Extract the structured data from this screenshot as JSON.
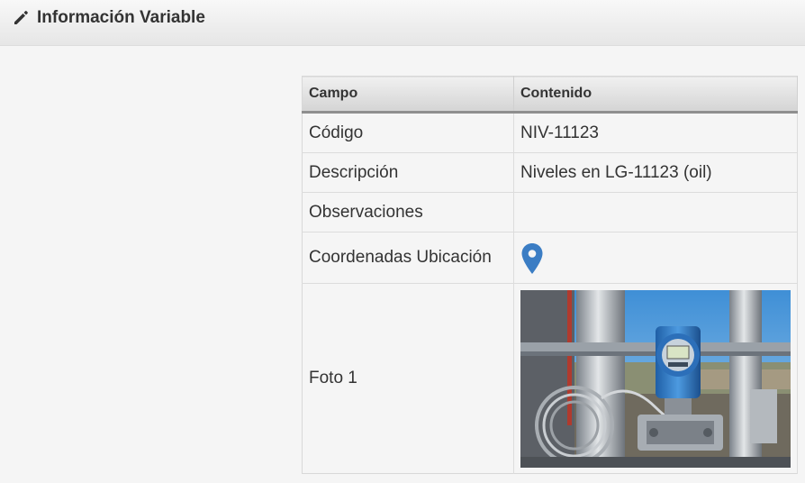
{
  "header": {
    "title": "Información Variable",
    "icon": "pencil-icon"
  },
  "table": {
    "columns": [
      "Campo",
      "Contenido"
    ],
    "rows": {
      "codigo": {
        "field": "Código",
        "value": "NIV-11123"
      },
      "descripcion": {
        "field": "Descripción",
        "value": "Niveles en LG-11123 (oil)"
      },
      "observaciones": {
        "field": "Observaciones",
        "value": ""
      },
      "coordenadas": {
        "field": "Coordenadas Ubicación",
        "icon": "map-marker-icon"
      },
      "foto": {
        "field": "Foto 1",
        "image": "level-transmitter-photo"
      }
    }
  },
  "colors": {
    "marker": "#3b7dc4",
    "header_bg": "#ebebeb"
  }
}
